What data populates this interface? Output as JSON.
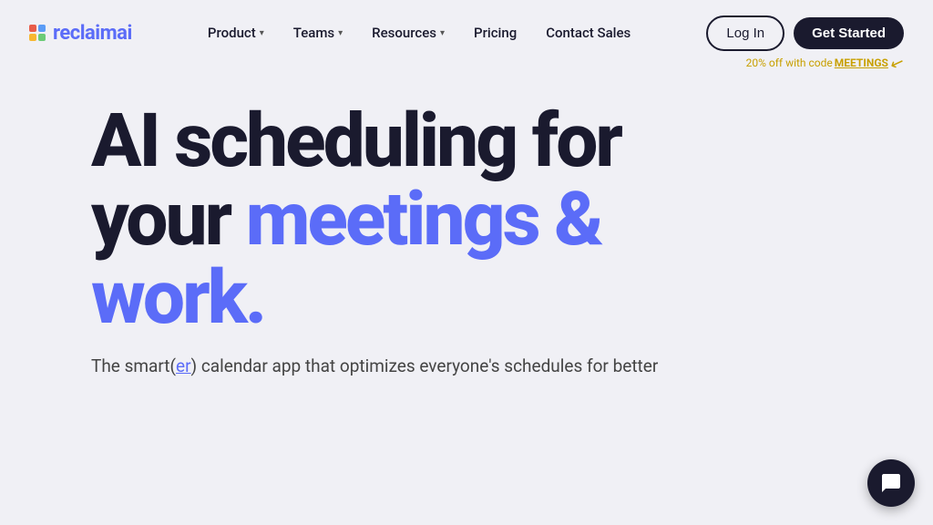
{
  "logo": {
    "text_part1": "reclaim",
    "text_part2": "ai"
  },
  "nav": {
    "links": [
      {
        "label": "Product",
        "has_dropdown": true
      },
      {
        "label": "Teams",
        "has_dropdown": true
      },
      {
        "label": "Resources",
        "has_dropdown": true
      },
      {
        "label": "Pricing",
        "has_dropdown": false
      },
      {
        "label": "Contact Sales",
        "has_dropdown": false
      }
    ],
    "login_label": "Log In",
    "get_started_label": "Get Started",
    "discount_text": "20% off with code ",
    "discount_code": "MEETINGS"
  },
  "hero": {
    "line1": "AI scheduling for",
    "line2_plain": "your ",
    "line2_highlight": "meetings &",
    "line3": "work.",
    "subtitle_start": "The smart(",
    "subtitle_link": "er",
    "subtitle_end": ") calendar app that optimizes everyone's schedules for better"
  }
}
